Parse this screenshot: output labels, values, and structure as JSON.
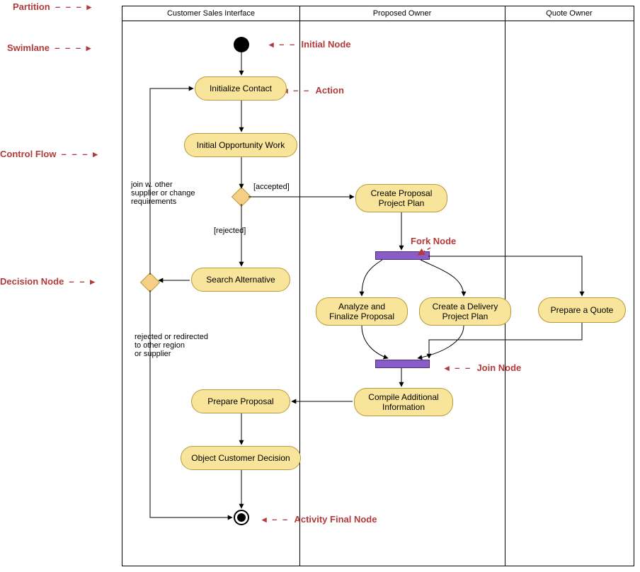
{
  "lanes": {
    "lane1": "Customer Sales Interface",
    "lane2": "Proposed Owner",
    "lane3": "Quote Owner"
  },
  "annotations": {
    "partition": "Partition",
    "swimlane": "Swimlane",
    "controlFlow": "Control Flow",
    "decisionNode": "Decision Node",
    "initialNode": "Initial Node",
    "action": "Action",
    "forkNode": "Fork Node",
    "joinNode": "Join Node",
    "activityFinal": "Activity Final Node"
  },
  "actions": {
    "initContact": "Initialize Contact",
    "initOpp": "Initial Opportunity Work",
    "searchAlt": "Search Alternative",
    "prepareProposal": "Prepare Proposal",
    "objectDecision": "Object Customer Decision",
    "createPlan": "Create Proposal\nProject Plan",
    "analyze": "Analyze and\nFinalize Proposal",
    "delivery": "Create a Delivery\nProject Plan",
    "quote": "Prepare a Quote",
    "compile": "Compile Additional\nInformation"
  },
  "guards": {
    "accepted": "[accepted]",
    "rejected": "[rejected]",
    "joinText": "join w. other\nsupplier or change\nrequirements",
    "rejectedText": "rejected or redirected\nto other region\nor supplier"
  }
}
